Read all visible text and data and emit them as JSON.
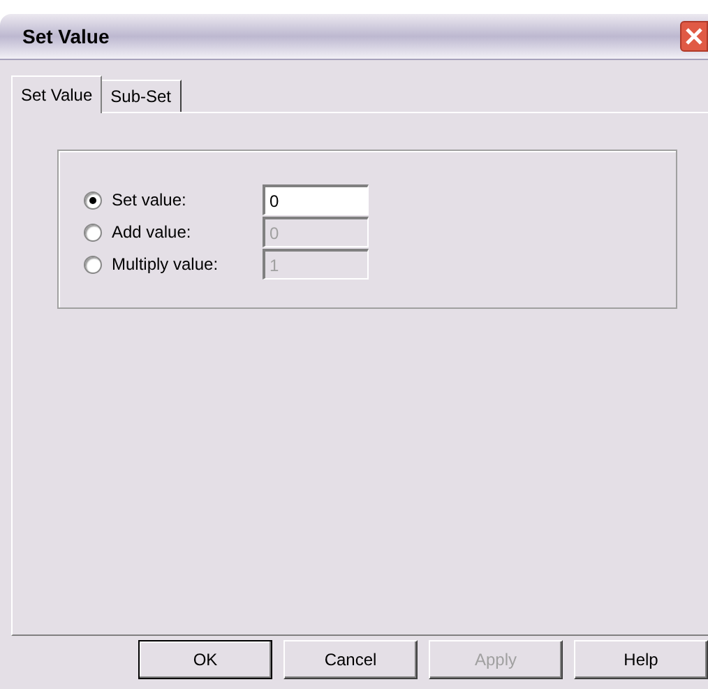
{
  "window": {
    "title": "Set Value"
  },
  "tabs": [
    {
      "label": "Set Value",
      "selected": true
    },
    {
      "label": "Sub-Set",
      "selected": false
    }
  ],
  "options": [
    {
      "label": "Set value:",
      "selected": true,
      "value": "0",
      "disabled": false
    },
    {
      "label": "Add value:",
      "selected": false,
      "value": "0",
      "disabled": true
    },
    {
      "label": "Multiply value:",
      "selected": false,
      "value": "1",
      "disabled": true
    }
  ],
  "buttons": [
    {
      "label": "OK",
      "default": true,
      "disabled": false
    },
    {
      "label": "Cancel",
      "default": false,
      "disabled": false
    },
    {
      "label": "Apply",
      "default": false,
      "disabled": true
    },
    {
      "label": "Help",
      "default": false,
      "disabled": false
    }
  ]
}
